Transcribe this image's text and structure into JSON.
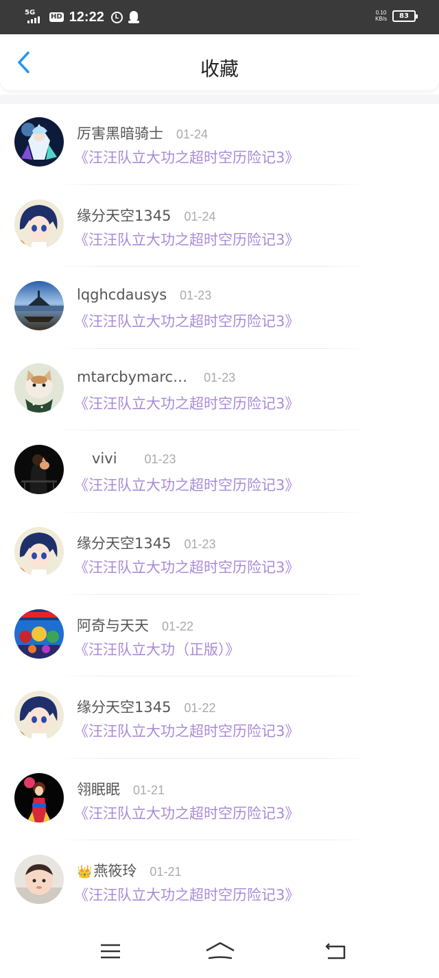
{
  "status_bar": {
    "network": "5G",
    "hd": "HD",
    "time": "12:22",
    "icon_1": "L",
    "net_speed_value": "0.10",
    "net_speed_unit": "KB/s",
    "battery": "83"
  },
  "header": {
    "title": "收藏",
    "back_icon": "chevron-left-icon",
    "accent_color": "#2196F3"
  },
  "favorites": [
    {
      "user": "厉害黑暗骑士",
      "date": "01-24",
      "title": "《汪汪队立大功之超时空历险记3》"
    },
    {
      "user": "缘分天空1345",
      "date": "01-24",
      "title": "《汪汪队立大功之超时空历险记3》"
    },
    {
      "user": "lqghcdausys",
      "date": "01-23",
      "title": "《汪汪队立大功之超时空历险记3》"
    },
    {
      "user": "mtarcbymarc…",
      "date": "01-23",
      "title": "《汪汪队立大功之超时空历险记3》"
    },
    {
      "user": "vivi",
      "date": "01-23",
      "title": "《汪汪队立大功之超时空历险记3》"
    },
    {
      "user": "缘分天空1345",
      "date": "01-23",
      "title": "《汪汪队立大功之超时空历险记3》"
    },
    {
      "user": "阿奇与天天",
      "date": "01-22",
      "title": "《汪汪队立大功（正版）》"
    },
    {
      "user": "缘分天空1345",
      "date": "01-22",
      "title": "《汪汪队立大功之超时空历险记3》"
    },
    {
      "user": "翎眠眠",
      "date": "01-21",
      "title": "《汪汪队立大功之超时空历险记3》"
    },
    {
      "user": "燕筱玲",
      "date": "01-21",
      "title": "《汪汪队立大功之超时空历险记3》",
      "badge": "crown-icon"
    }
  ],
  "colors": {
    "title_text": "#a98ad8",
    "user_text": "#555555",
    "date_text": "#aaaaaa"
  },
  "nav_bar": {
    "icons": [
      "menu-icon",
      "home-icon",
      "back-icon"
    ]
  }
}
